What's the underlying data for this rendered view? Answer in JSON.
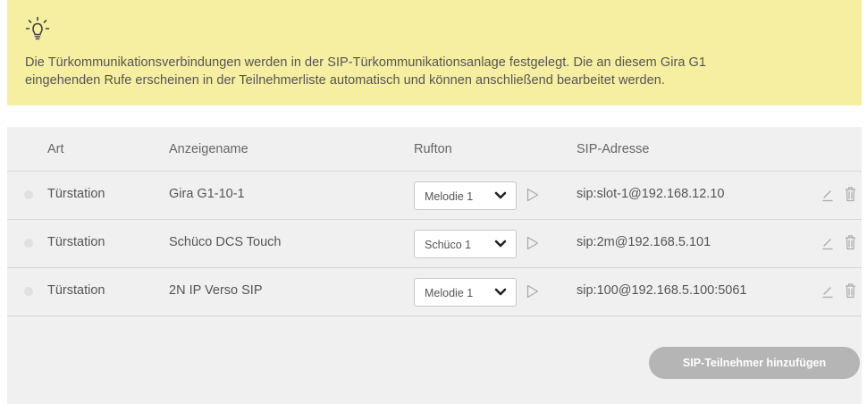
{
  "info": {
    "icon": "lightbulb-icon",
    "line1": "Die Türkommunikationsverbindungen werden in der SIP-Türkommunikationsanlage festgelegt. Die an diesem Gira G1",
    "line2": "eingehenden Rufe erscheinen in der Teilnehmerliste automatisch und können anschließend bearbeitet werden.",
    "background_color": "#f6eea0"
  },
  "table": {
    "headers": {
      "art": "Art",
      "anzeigename": "Anzeigename",
      "rufton": "Rufton",
      "sip_adresse": "SIP-Adresse"
    },
    "rows": [
      {
        "art": "Türstation",
        "anzeigename": "Gira G1-10-1",
        "rufton": "Melodie 1",
        "sip_adresse": "sip:slot-1@192.168.12.10"
      },
      {
        "art": "Türstation",
        "anzeigename": "Schüco DCS Touch",
        "rufton": "Schüco 1",
        "sip_adresse": "sip:2m@192.168.5.101"
      },
      {
        "art": "Türstation",
        "anzeigename": "2N IP Verso SIP",
        "rufton": "Melodie 1",
        "sip_adresse": "sip:100@192.168.5.100:5061"
      }
    ]
  },
  "actions": {
    "add_label": "SIP-Teilnehmer hinzufügen"
  },
  "icons": {
    "status": "status-dot-icon",
    "dropdown": "chevron-down-icon",
    "play": "play-icon",
    "edit": "pencil-icon",
    "delete": "trash-icon"
  },
  "colors": {
    "panel": "#f0f0f0",
    "button": "#b5b5b5",
    "text": "#555555"
  }
}
